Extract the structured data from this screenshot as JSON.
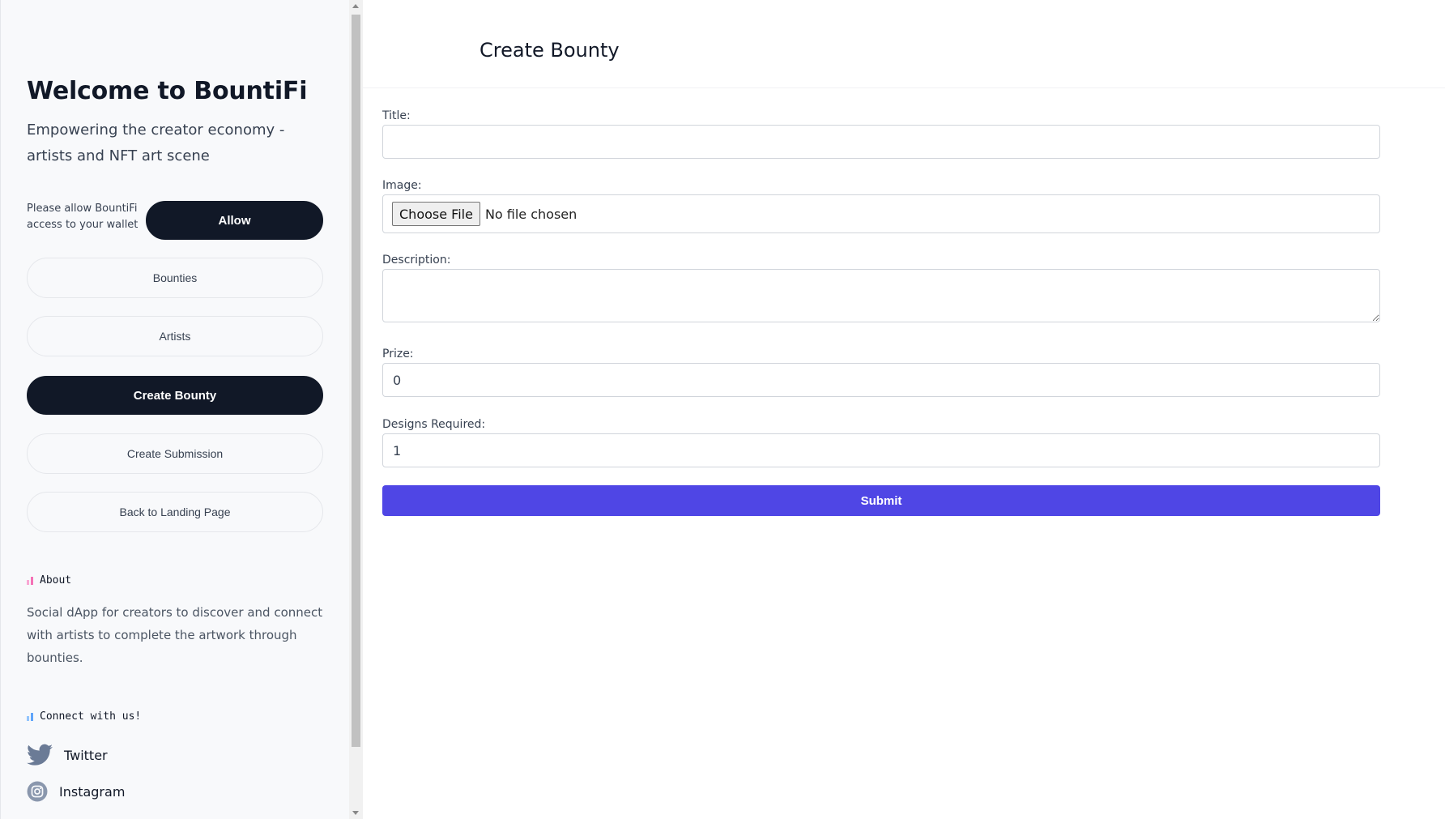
{
  "sidebar": {
    "welcome": "Welcome to BountiFi",
    "tagline": "Empowering the creator economy - artists and NFT art scene",
    "allow_prompt": "Please allow BountiFi access to your wallet",
    "allow_label": "Allow",
    "nav": [
      {
        "label": "Bounties",
        "active": false
      },
      {
        "label": "Artists",
        "active": false
      },
      {
        "label": "Create Bounty",
        "active": true
      },
      {
        "label": "Create Submission",
        "active": false
      },
      {
        "label": "Back to Landing Page",
        "active": false
      }
    ],
    "about": {
      "heading": "About",
      "text": "Social dApp for creators to discover and connect with artists to complete the artwork through bounties."
    },
    "connect": {
      "heading": "Connect with us!",
      "links": [
        {
          "label": "Twitter",
          "icon": "twitter-icon"
        },
        {
          "label": "Instagram",
          "icon": "instagram-icon"
        }
      ]
    }
  },
  "header": {
    "title": "Create Bounty"
  },
  "form": {
    "title_label": "Title:",
    "title_value": "",
    "image_label": "Image:",
    "image_button": "Choose File",
    "image_status": "No file chosen",
    "description_label": "Description:",
    "description_value": "",
    "prize_label": "Prize:",
    "prize_value": "0",
    "designs_label": "Designs Required:",
    "designs_value": "1",
    "submit_label": "Submit"
  },
  "colors": {
    "accent": "#4f46e5",
    "dark": "#111827",
    "about_bars": [
      "#f9a8d4",
      "#f472b6"
    ],
    "connect_bars": [
      "#93c5fd",
      "#60a5fa"
    ]
  }
}
